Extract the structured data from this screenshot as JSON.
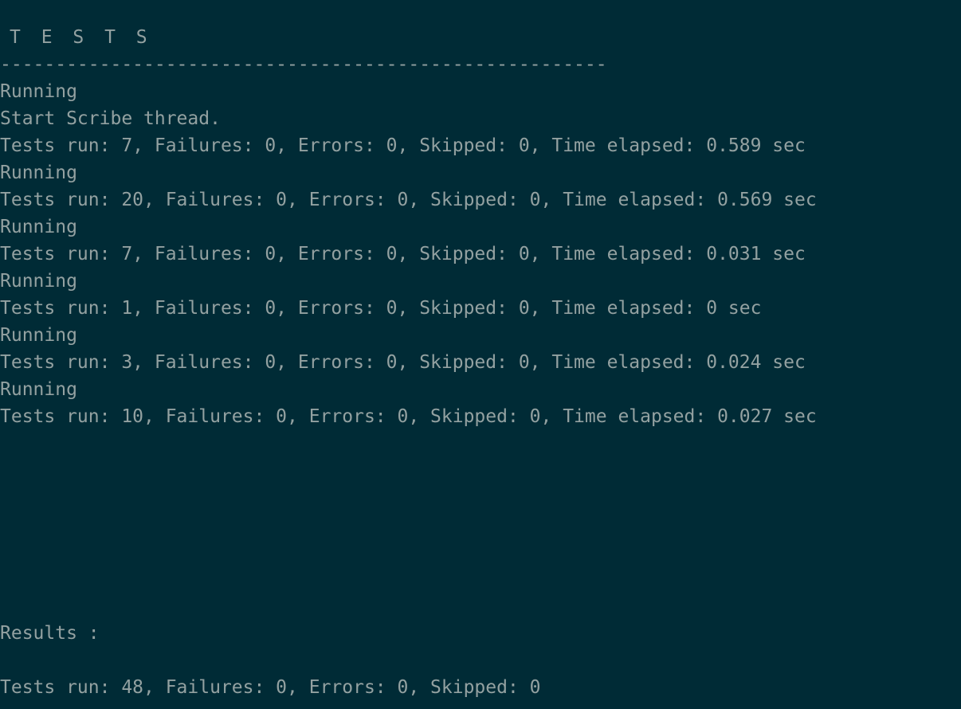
{
  "terminal": {
    "header": "T E S T S",
    "separator": "-------------------------------------------------------",
    "lines": [
      "Running",
      "Start Scribe thread.",
      "Tests run: 7, Failures: 0, Errors: 0, Skipped: 0, Time elapsed: 0.589 sec",
      "Running",
      "Tests run: 20, Failures: 0, Errors: 0, Skipped: 0, Time elapsed: 0.569 sec",
      "Running",
      "Tests run: 7, Failures: 0, Errors: 0, Skipped: 0, Time elapsed: 0.031 sec",
      "Running",
      "Tests run: 1, Failures: 0, Errors: 0, Skipped: 0, Time elapsed: 0 sec",
      "Running",
      "Tests run: 3, Failures: 0, Errors: 0, Skipped: 0, Time elapsed: 0.024 sec",
      "Running",
      "Tests run: 10, Failures: 0, Errors: 0, Skipped: 0, Time elapsed: 0.027 sec"
    ],
    "results_label": "Results :",
    "summary": "Tests run: 48, Failures: 0, Errors: 0, Skipped: 0"
  },
  "colors": {
    "background": "#002b36",
    "text": "#93a1a1"
  }
}
